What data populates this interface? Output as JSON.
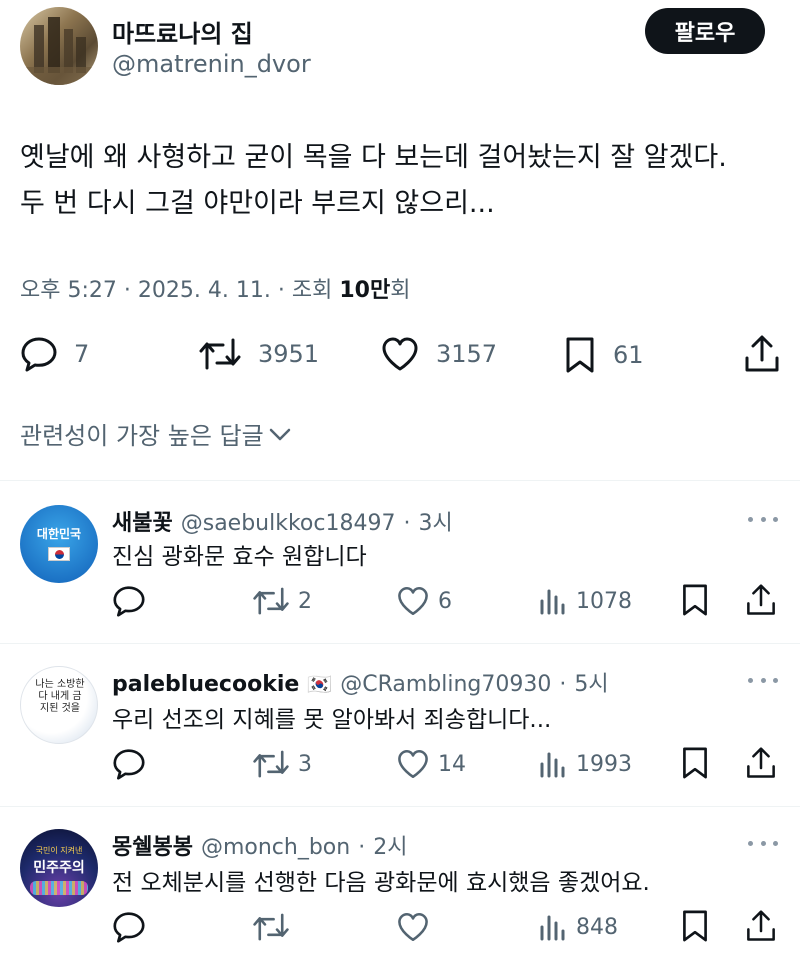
{
  "tweet": {
    "display_name": "마뜨료나의 집",
    "handle": "@matrenin_dvor",
    "follow_label": "팔로우",
    "text_line1": "옛날에 왜 사형하고 굳이 목을 다 보는데 걸어놨는지 잘 알겠다.",
    "text_line2": "두 번 다시 그걸 야만이라 부르지 않으리...",
    "time": "오후 5:27",
    "date": "2025. 4. 11.",
    "views_prefix": "조회",
    "views_count": "10만",
    "views_suffix": "회",
    "replies": "7",
    "retweets": "3951",
    "likes": "3157",
    "bookmarks": "61"
  },
  "sort_label": "관련성이 가장 높은 답글",
  "replies": [
    {
      "name": "새불꽃",
      "handle": "@saebulkkoc18497",
      "time": "3시",
      "text": "진심 광화문 효수 원합니다",
      "replies": "",
      "retweets": "2",
      "likes": "6",
      "views": "1078",
      "avatar_text": "대한민국"
    },
    {
      "name": "palebluecookie",
      "name_flag": "🇰🇷",
      "handle": "@CRambling70930",
      "time": "5시",
      "text": "우리 선조의 지혜를 못 알아봐서 죄송합니다...",
      "replies": "",
      "retweets": "3",
      "likes": "14",
      "views": "1993",
      "avatar_text": "나는 소방한다 내게 금지된 것을"
    },
    {
      "name": "몽쉘봉봉",
      "handle": "@monch_bon",
      "time": "2시",
      "text": "전 오체분시를 선행한 다음 광화문에 효시했음 좋겠어요.",
      "replies": "",
      "retweets": "",
      "likes": "",
      "views": "848",
      "avatar_top_text": "국민이 지켜낸",
      "avatar_text": "민주주의"
    }
  ]
}
